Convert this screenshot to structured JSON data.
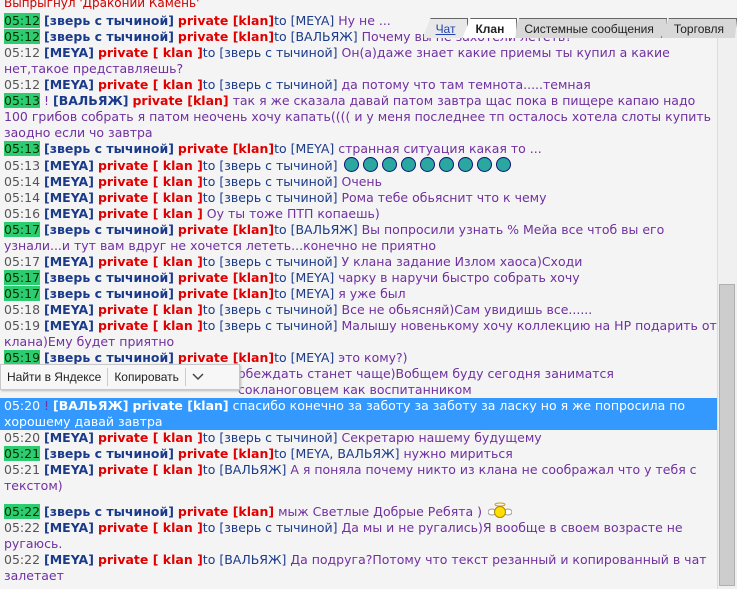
{
  "header_line": "Выпрыгнул 'Драконий Камень'",
  "tabs": [
    "Чат",
    "Клан",
    "Системные сообщения",
    "Торговля"
  ],
  "context_menu": {
    "search_label": "Найти в Яндексе",
    "copy_label": "Копировать",
    "expand_icon": "chevron-down-icon"
  },
  "messages": [
    {
      "time": "05:12",
      "user": "[зверь с тычиной]",
      "priv": "private [klan]",
      "to": "to [MEYA]",
      "text": "Ну не ...",
      "tg": true
    },
    {
      "time": "05:12",
      "user": "[зверь с тычиной]",
      "priv": "private [klan]",
      "to": "to [ВАЛЬЯЖ]",
      "text": "Почему вы не захотели лететь?",
      "tg": true
    },
    {
      "time": "05:12",
      "user": "[MEYA]",
      "priv": "private [ klan ]",
      "to": "to [зверь с тычиной]",
      "text": "Он(а)даже знает какие приемы ты купил а какие нет,такое представляешь?"
    },
    {
      "time": "05:12",
      "user": "[MEYA]",
      "priv": "private [ klan ]",
      "to": "to [зверь с тычиной]",
      "text": "да потому что там темнота.....темная"
    },
    {
      "time": "05:13",
      "user": "[ВАЛЬЯЖ]",
      "priv": "private [klan]",
      "to": "",
      "text": "так я же сказала давай патом завтра щас пока в пищере капаю надо 100 грибов собрать я патом неочень хочу капать(((( и у меня последнее тп осталось хотела слоты купить заодно если чо завтра",
      "tg": true,
      "mark": "!"
    },
    {
      "time": "05:13",
      "user": "[зверь с тычиной]",
      "priv": "private [klan]",
      "to": "to [MEYA]",
      "text": "странная ситуация какая то ...",
      "tg": true
    },
    {
      "time": "05:13",
      "user": "[MEYA]",
      "priv": "private [ klan ]",
      "to": "to [зверь с тычиной]",
      "text": "",
      "smiles": 9
    },
    {
      "time": "05:14",
      "user": "[MEYA]",
      "priv": "private [ klan ]",
      "to": "to [зверь с тычиной]",
      "text": "Очень"
    },
    {
      "time": "05:14",
      "user": "[MEYA]",
      "priv": "private [ klan ]",
      "to": "to [зверь с тычиной]",
      "text": "Рома тебе обьяснит что к чему"
    },
    {
      "time": "05:16",
      "user": "[MEYA]",
      "priv": "private [ klan ]",
      "to": "",
      "text": "Оу ты тоже ПТП копаешь)"
    },
    {
      "time": "05:17",
      "user": "[зверь с тычиной]",
      "priv": "private [klan]",
      "to": "to [ВАЛЬЯЖ]",
      "text": "Вы попросили узнать % Мейа все чтоб вы его узнали...и тут вам вдруг не хочется лететь...конечно не приятно",
      "tg": true
    },
    {
      "time": "05:17",
      "user": "[MEYA]",
      "priv": "private [ klan ]",
      "to": "to [зверь с тычиной]",
      "text": "У клана задание Излом хаоса)Сходи"
    },
    {
      "time": "05:17",
      "user": "[зверь с тычиной]",
      "priv": "private [klan]",
      "to": "to [MEYA]",
      "text": "чарку в наручи быстро собрать хочу",
      "tg": true
    },
    {
      "time": "05:17",
      "user": "[зверь с тычиной]",
      "priv": "private [klan]",
      "to": "to [MEYA]",
      "text": "я уже был",
      "tg": true
    },
    {
      "time": "05:18",
      "user": "[MEYA]",
      "priv": "private [ klan ]",
      "to": "to [зверь с тычиной]",
      "text": "Все не обьясняй)Сам увидишь все......"
    },
    {
      "time": "05:19",
      "user": "[MEYA]",
      "priv": "private [ klan ]",
      "to": "to [зверь с тычиной]",
      "text": "Малышу новенькому хочу коллекцию на НР подарить от клана)Ему будет приятно"
    },
    {
      "time": "05:19",
      "user": "[зверь с тычиной]",
      "priv": "private [klan]",
      "to": "to [MEYA]",
      "text": "это кому?)",
      "tg": true
    },
    {
      "time": "",
      "user": "",
      "priv": "",
      "to": "",
      "text": "обеждать станет чаще)Вобщем буду сегодня заниматся сокланоговцем как воспитанником",
      "indent": true
    },
    {
      "time": "05:20",
      "user": "[ВАЛЬЯЖ]",
      "priv": "private [klan]",
      "to": "",
      "text": "спасибо конечно за заботу за заботу за ласку но я же попросила по хорошему давай завтра",
      "sel": true,
      "mark": "!"
    },
    {
      "time": "05:20",
      "user": "[MEYA]",
      "priv": "private [ klan ]",
      "to": "to [зверь с тычиной]",
      "text": "Секретарю нашему будущему"
    },
    {
      "time": "05:21",
      "user": "[зверь с тычиной]",
      "priv": "private [klan]",
      "to": "to [MEYA, ВАЛЬЯЖ]",
      "text": "нужно мириться",
      "tg": true
    },
    {
      "time": "05:21",
      "user": "[MEYA]",
      "priv": "private [ klan ]",
      "to": "to [ВАЛЬЯЖ]",
      "text": "А я поняла почему никто из клана не соображал что у тебя с текстом)"
    },
    {
      "time": "05:22",
      "user": "[зверь с тычиной]",
      "priv": "private [klan]",
      "to": "",
      "text": "мыж Светлые Добрые Ребята )",
      "tg": true,
      "gap": true,
      "angel": true
    },
    {
      "time": "05:22",
      "user": "[MEYA]",
      "priv": "private [ klan ]",
      "to": "to [зверь с тычиной]",
      "text": "Да мы и не ругались)Я вообще в своем возрасте не ругаюсь."
    },
    {
      "time": "05:22",
      "user": "[MEYA]",
      "priv": "private [ klan ]",
      "to": "to [ВАЛЬЯЖ]",
      "text": "Да подруга?Потому что текст резанный и копированный в чат залетает"
    }
  ]
}
